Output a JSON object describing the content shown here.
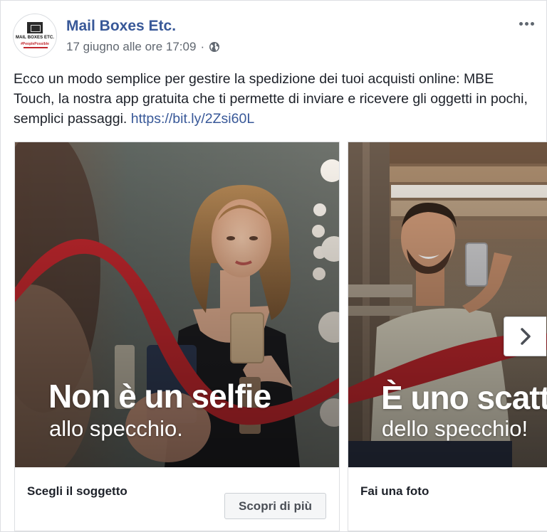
{
  "post": {
    "author": "Mail Boxes Etc.",
    "timestamp": "17 giugno alle ore 17:09",
    "separator": "·",
    "audience_icon": "globe-icon",
    "menu_icon": "more-dots-icon",
    "text": "Ecco un modo semplice per gestire la spedizione dei tuoi acquisti online: MBE Touch, la nostra app gratuita che ti permette di inviare e ricevere gli oggetti in pochi, semplici passaggi. ",
    "link": "https://bit.ly/2Zsi60L",
    "avatar": {
      "logo_text": "MAIL BOXES ETC.",
      "tagline": "#PeoplePossible"
    }
  },
  "carousel": {
    "cards": [
      {
        "overlay_title": "Non è un selfie",
        "overlay_subtitle": "allo specchio.",
        "caption": "Scegli il soggetto",
        "cta": "Scopri di più"
      },
      {
        "overlay_title": "È uno scatt",
        "overlay_subtitle": "dello specchio!",
        "caption": "Fai una foto"
      }
    ],
    "next_icon": "chevron-right-icon"
  },
  "colors": {
    "link": "#385898",
    "brand_red": "#c1272d",
    "text": "#1d2129",
    "meta": "#606770"
  }
}
